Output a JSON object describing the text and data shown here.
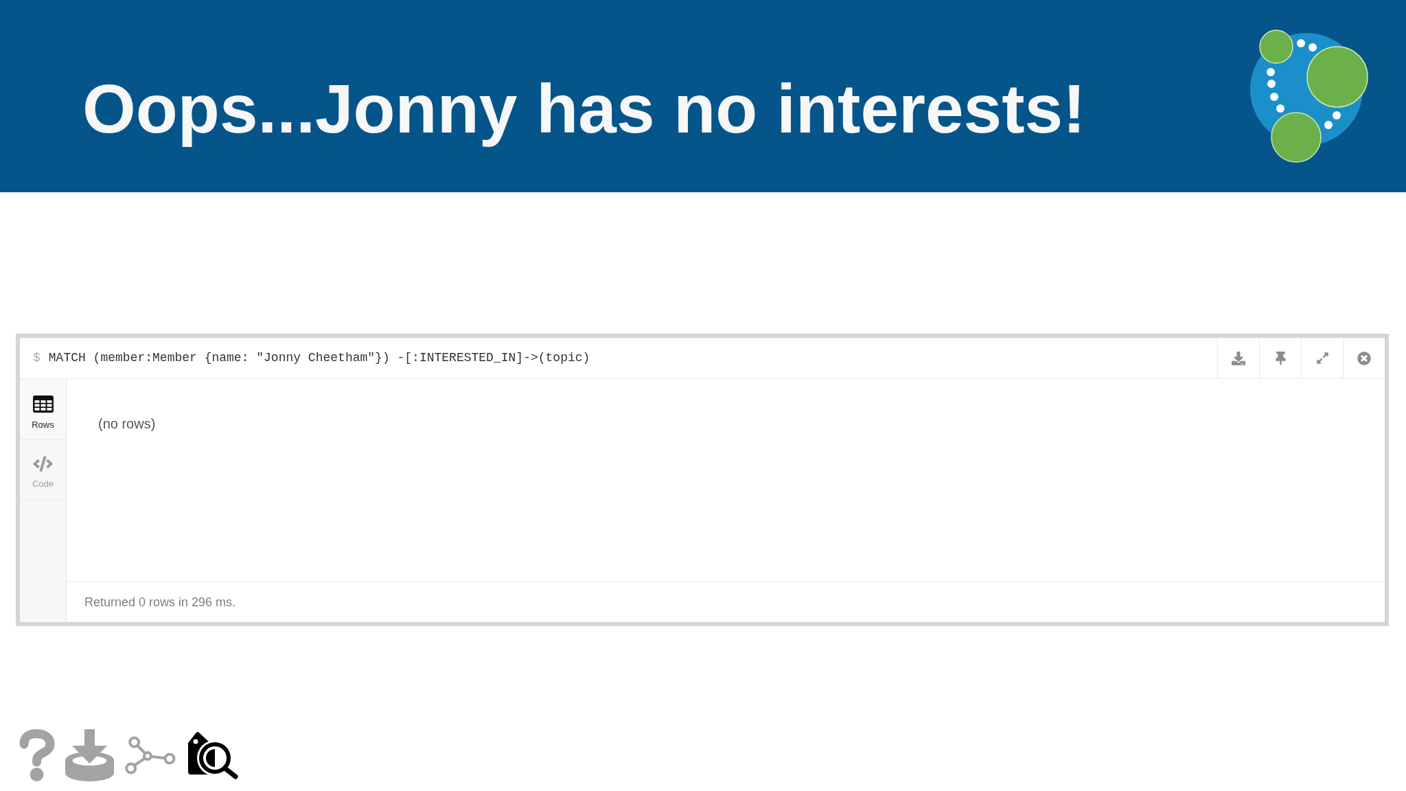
{
  "slide": {
    "title": "Oops...Jonny has no interests!"
  },
  "query_panel": {
    "prompt": "$",
    "query": "MATCH (member:Member {name: \"Jonny Cheetham\"}) -[:INTERESTED_IN]->(topic)",
    "view_tabs": [
      {
        "label": "Rows",
        "kind": "table",
        "selected": true
      },
      {
        "label": "Code",
        "kind": "code",
        "selected": false
      }
    ],
    "result_message": "(no rows)",
    "status": "Returned 0 rows in 296 ms."
  },
  "bottom_nav": [
    {
      "kind": "help",
      "selected": false
    },
    {
      "kind": "import",
      "selected": false
    },
    {
      "kind": "graph",
      "selected": false
    },
    {
      "kind": "tag-search",
      "selected": true
    }
  ]
}
